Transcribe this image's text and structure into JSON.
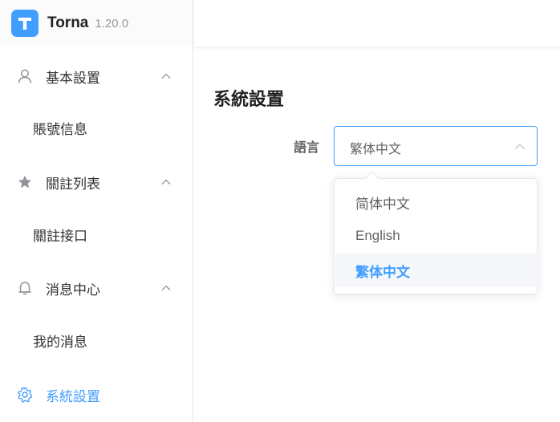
{
  "brand": {
    "name": "Torna",
    "version": "1.20.0",
    "logo_letter": "T",
    "accent": "#409eff"
  },
  "sidebar": {
    "groups": [
      {
        "label": "基本設置",
        "icon": "user-icon",
        "expanded": true,
        "items": [
          {
            "label": "賬號信息"
          }
        ]
      },
      {
        "label": "關註列表",
        "icon": "star-icon",
        "expanded": true,
        "items": [
          {
            "label": "關註接口"
          }
        ]
      },
      {
        "label": "消息中心",
        "icon": "bell-icon",
        "expanded": true,
        "items": [
          {
            "label": "我的消息"
          }
        ]
      }
    ],
    "active_item": {
      "label": "系統設置",
      "icon": "gear-icon"
    }
  },
  "main": {
    "title": "系統設置",
    "language": {
      "label": "語言",
      "selected": "繁体中文",
      "options": [
        "简体中文",
        "English",
        "繁体中文"
      ]
    }
  }
}
